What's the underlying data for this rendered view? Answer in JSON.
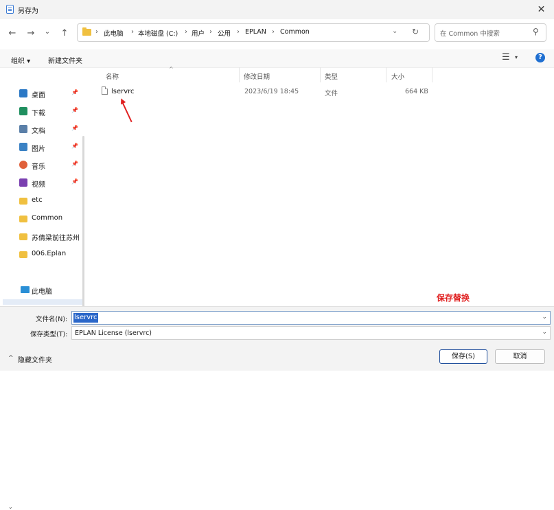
{
  "window": {
    "title": "另存为",
    "close_glyph": "✕"
  },
  "nav": {
    "back": "←",
    "forward": "→",
    "recent": "⌄",
    "up": "↑"
  },
  "address": {
    "crumbs": [
      "此电脑",
      "本地磁盘 (C:)",
      "用户",
      "公用",
      "EPLAN",
      "Common"
    ],
    "separator": "›",
    "chevron": "⌄",
    "refresh": "↻"
  },
  "search": {
    "placeholder": "在 Common 中搜索",
    "icon": "⚲"
  },
  "toolbar": {
    "organize": "组织 ▾",
    "new_folder": "新建文件夹",
    "view_icon": "☰",
    "view_caret": "▾",
    "help": "?"
  },
  "sidebar": {
    "items": [
      {
        "label": "桌面",
        "icon": "desktop-icon",
        "color": "#2b78c5",
        "pinned": true
      },
      {
        "label": "下载",
        "icon": "download-icon",
        "color": "#1f8f5f",
        "pinned": true
      },
      {
        "label": "文档",
        "icon": "document-icon",
        "color": "#5a7fa8",
        "pinned": true
      },
      {
        "label": "图片",
        "icon": "picture-icon",
        "color": "#3b82c4",
        "pinned": true
      },
      {
        "label": "音乐",
        "icon": "music-icon",
        "color": "#e0603a",
        "pinned": true
      },
      {
        "label": "视频",
        "icon": "video-icon",
        "color": "#7a3fb0",
        "pinned": true
      },
      {
        "label": "etc",
        "icon": "folder-icon",
        "color": "#f0c040",
        "pinned": false
      },
      {
        "label": "Common",
        "icon": "folder-icon",
        "color": "#f0c040",
        "pinned": false
      },
      {
        "label": "苏倩梁前往苏州",
        "icon": "folder-icon",
        "color": "#f0c040",
        "pinned": false
      },
      {
        "label": "006.Eplan",
        "icon": "folder-icon",
        "color": "#f0c040",
        "pinned": false
      }
    ],
    "pin_glyph": "📌",
    "this_pc": "此电脑"
  },
  "columns": {
    "name": "名称",
    "modified": "修改日期",
    "type": "类型",
    "size": "大小"
  },
  "files": [
    {
      "name": "lservrc",
      "modified": "2023/6/19 18:45",
      "type": "文件",
      "size": "664 KB"
    }
  ],
  "annotation": {
    "text": "保存替换",
    "color": "#e02020"
  },
  "form": {
    "filename_label": "文件名(N):",
    "filename_value": "lservrc",
    "filetype_label": "保存类型(T):",
    "filetype_value": "EPLAN License (lservrc)",
    "hide_folders": "隐藏文件夹",
    "save": "保存(S)",
    "cancel": "取消"
  }
}
